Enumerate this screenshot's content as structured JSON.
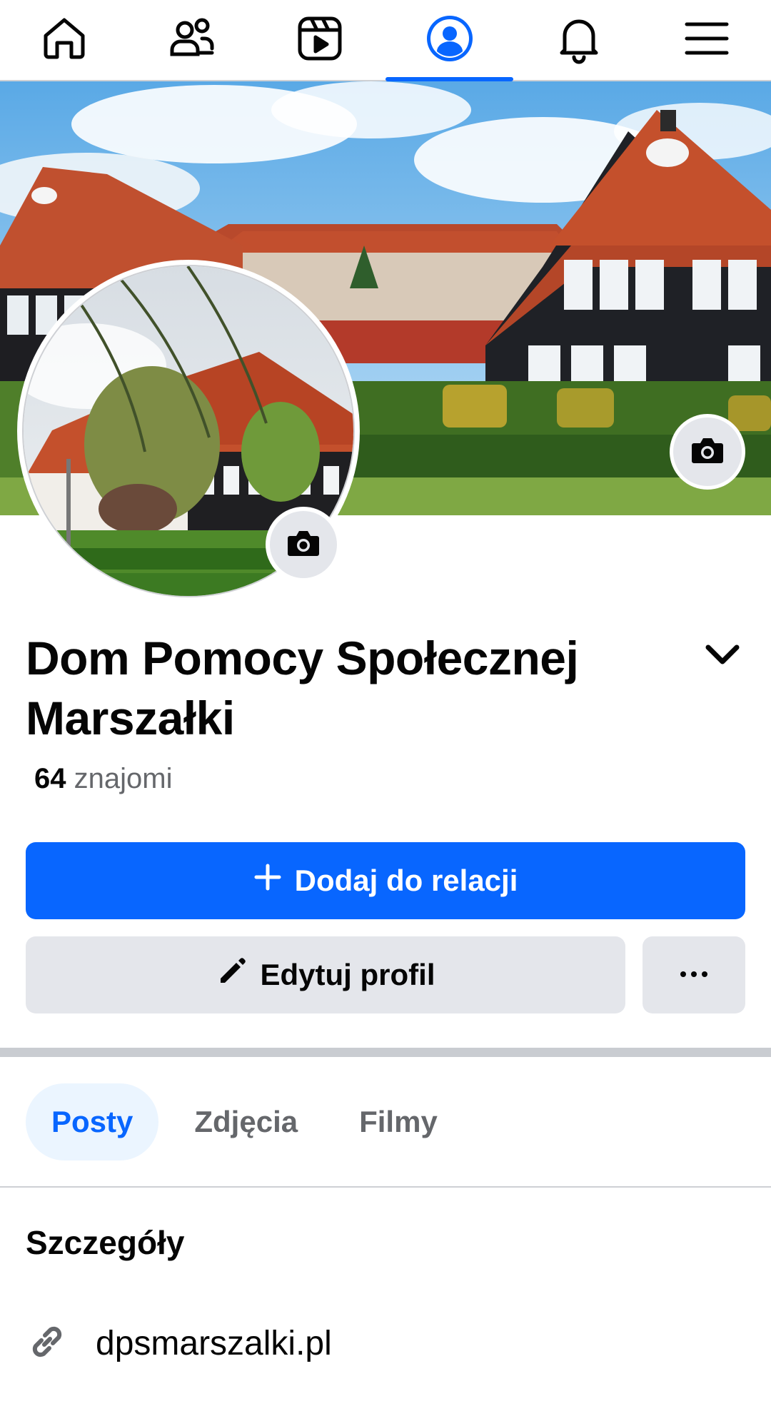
{
  "nav": {
    "items": [
      {
        "icon": "home-icon",
        "active": false
      },
      {
        "icon": "friends-icon",
        "active": false
      },
      {
        "icon": "video-icon",
        "active": false
      },
      {
        "icon": "profile-icon",
        "active": true
      },
      {
        "icon": "bell-icon",
        "active": false
      },
      {
        "icon": "menu-icon",
        "active": false
      }
    ],
    "accent": "#0866ff"
  },
  "profile": {
    "name": "Dom Pomocy Społecznej Marszałki",
    "friends_count": "64",
    "friends_label": "znajomi"
  },
  "actions": {
    "add_story_label": "Dodaj do relacji",
    "edit_profile_label": "Edytuj profil",
    "more_label": "···"
  },
  "tabs": [
    {
      "label": "Posty",
      "active": true
    },
    {
      "label": "Zdjęcia",
      "active": false
    },
    {
      "label": "Filmy",
      "active": false
    }
  ],
  "details": {
    "title": "Szczegóły",
    "website": "dpsmarszalki.pl"
  },
  "colors": {
    "primary": "#0866ff",
    "secondary_bg": "#e4e6eb",
    "muted_text": "#65676b"
  }
}
